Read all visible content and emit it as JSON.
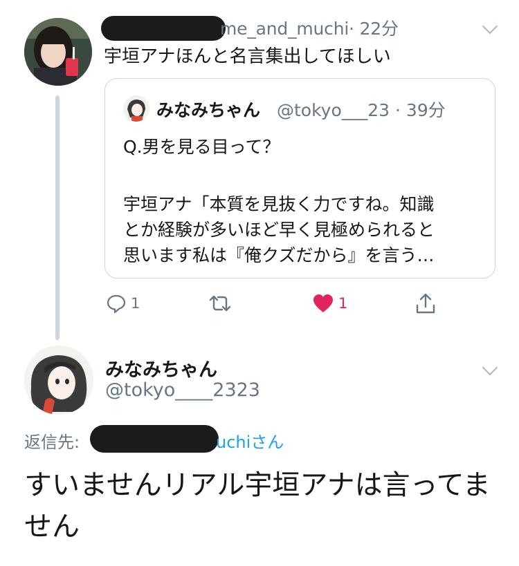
{
  "first_tweet": {
    "handle_visible": "me_and_muchi",
    "time": "· 22分",
    "text": "宇垣アナほんと名言集出してほしい"
  },
  "quoted_tweet": {
    "name": "みなみちゃん",
    "handle_time": "@tokyo___23 · 39分",
    "lines": [
      "Q.男を見る目って？",
      "宇垣アナ「本質を見抜く力ですね。知識",
      "とか経験が多いほど早く見極められると",
      "思います私は『俺クズだから』を言う…"
    ]
  },
  "actions": {
    "reply_count": "1",
    "retweet_count": "",
    "like_count": "1",
    "liked": true
  },
  "reply_tweet": {
    "name": "みなみちゃん",
    "handle": "@tokyo____2323",
    "replying_label": "返信先:",
    "replying_user_visible": "uchiさん",
    "text": "すいませんリアル宇垣アナは言ってません"
  },
  "colors": {
    "link": "#1da1f2",
    "muted": "#657786",
    "like": "#e0245e",
    "border": "#ccd6dd"
  },
  "icons": [
    "reply-icon",
    "retweet-icon",
    "heart-icon",
    "share-icon",
    "chevron-down-icon"
  ]
}
